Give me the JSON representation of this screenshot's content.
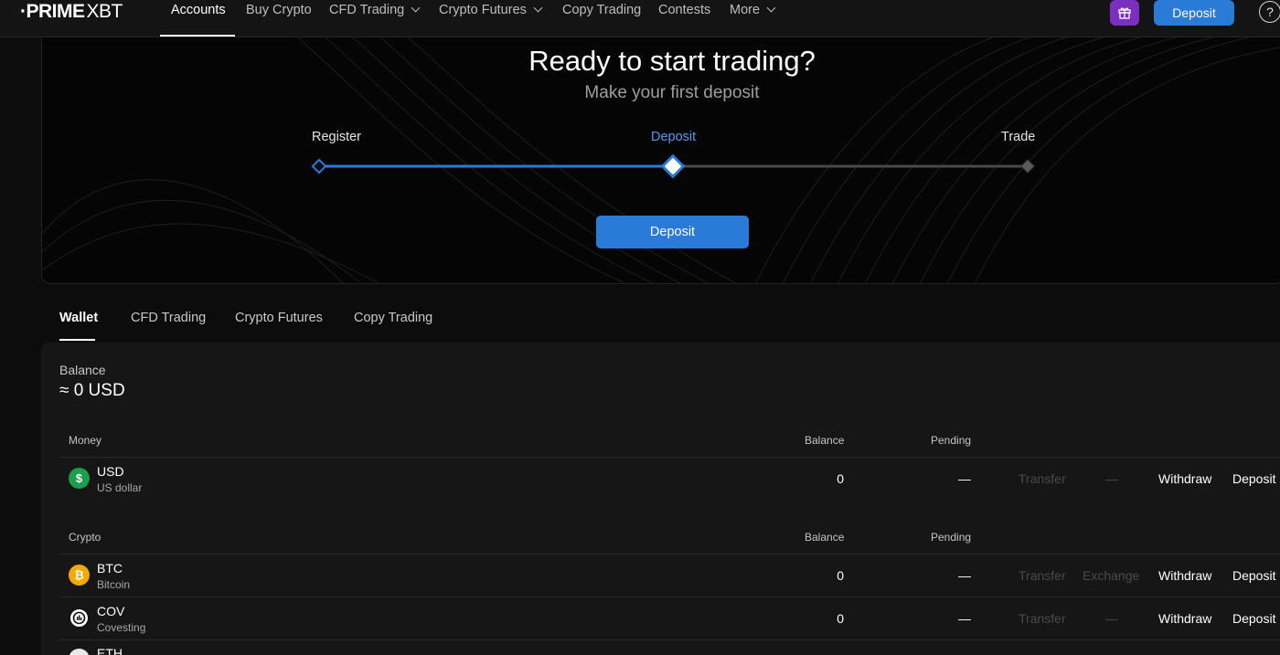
{
  "brand": {
    "logo_main": "·PRIME",
    "logo_sub": "XBT"
  },
  "nav": {
    "items": [
      {
        "label": "Accounts",
        "active": true
      },
      {
        "label": "Buy Crypto"
      },
      {
        "label": "CFD Trading",
        "dropdown": true
      },
      {
        "label": "Crypto Futures",
        "dropdown": true
      },
      {
        "label": "Copy Trading"
      },
      {
        "label": "Contests"
      },
      {
        "label": "More",
        "dropdown": true
      }
    ],
    "deposit_label": "Deposit",
    "help_label": "?",
    "gift_icon": "gift-icon"
  },
  "hero": {
    "title": "Ready to start trading?",
    "subtitle": "Make your first deposit",
    "steps": [
      {
        "label": "Register",
        "state": "done"
      },
      {
        "label": "Deposit",
        "state": "current"
      },
      {
        "label": "Trade",
        "state": "pending"
      }
    ],
    "progress_fraction": 0.5,
    "deposit_label": "Deposit"
  },
  "tabs": [
    {
      "label": "Wallet",
      "active": true
    },
    {
      "label": "CFD Trading"
    },
    {
      "label": "Crypto Futures"
    },
    {
      "label": "Copy Trading"
    }
  ],
  "wallet": {
    "balance_label": "Balance",
    "balance_value": "≈ 0 USD",
    "money": {
      "header": "Money",
      "col_balance": "Balance",
      "col_pending": "Pending",
      "rows": [
        {
          "code": "USD",
          "name": "US dollar",
          "icon": "dollar-icon",
          "balance": "0",
          "pending": "—",
          "transfer": "Transfer",
          "exchange": "—",
          "withdraw": "Withdraw",
          "deposit": "Deposit"
        }
      ]
    },
    "crypto": {
      "header": "Crypto",
      "col_balance": "Balance",
      "col_pending": "Pending",
      "rows": [
        {
          "code": "BTC",
          "name": "Bitcoin",
          "icon": "bitcoin-icon",
          "balance": "0",
          "pending": "—",
          "transfer": "Transfer",
          "exchange": "Exchange",
          "withdraw": "Withdraw",
          "deposit": "Deposit"
        },
        {
          "code": "COV",
          "name": "Covesting",
          "icon": "covesting-icon",
          "balance": "0",
          "pending": "—",
          "transfer": "Transfer",
          "exchange": "—",
          "withdraw": "Withdraw",
          "deposit": "Deposit"
        },
        {
          "code": "ETH",
          "name": "",
          "icon": "ethereum-icon"
        }
      ]
    }
  },
  "colors": {
    "accent": "#2a7ad8",
    "progress_active": "#2a7ad8",
    "progress_inactive": "#4a4a4a",
    "gift": "#7b2fbe",
    "usd_icon": "#1a9e4b",
    "btc_icon": "#f2a900"
  }
}
